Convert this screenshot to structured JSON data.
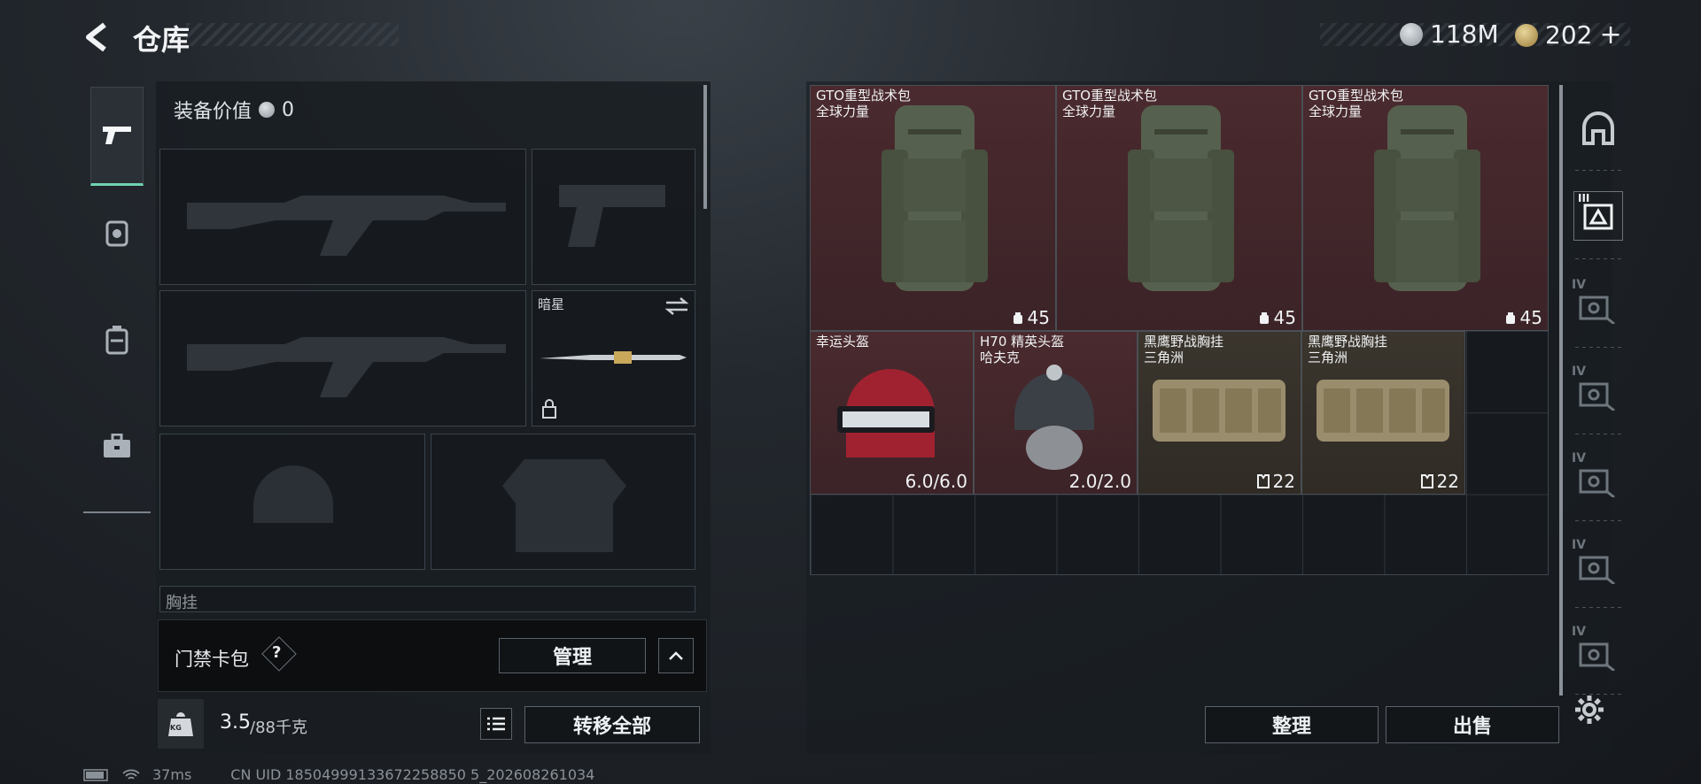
{
  "header": {
    "title": "仓库",
    "currency_silver": "118M",
    "currency_gold": "202",
    "add_symbol": "+"
  },
  "loadout": {
    "equip_value_label": "装备价值",
    "equip_value": "0",
    "melee_label": "暗星",
    "chest_label_partial": "胸挂",
    "card_label": "门禁卡包",
    "help_symbol": "?",
    "manage_button": "管理",
    "weight_value": "3.5",
    "weight_max": "/88千克",
    "transfer_all": "转移全部",
    "weight_icon_text": "KG"
  },
  "status": {
    "ping": "37ms",
    "uid": "CN UID 18504999133672258850 5_202608261034"
  },
  "items": [
    {
      "name": "GTO重型战术包",
      "sub": "全球力量",
      "value": "45",
      "type": "backpack",
      "color": "red"
    },
    {
      "name": "GTO重型战术包",
      "sub": "全球力量",
      "value": "45",
      "type": "backpack",
      "color": "red"
    },
    {
      "name": "GTO重型战术包",
      "sub": "全球力量",
      "value": "45",
      "type": "backpack",
      "color": "red"
    },
    {
      "name": "幸运头盔",
      "sub": "",
      "value": "6.0/6.0",
      "type": "helmet-red",
      "color": "red"
    },
    {
      "name": "H70 精英头盔",
      "sub": "哈夫克",
      "value": "2.0/2.0",
      "type": "helmet-grey",
      "color": "red"
    },
    {
      "name": "黑鹰野战胸挂",
      "sub": "三角洲",
      "value": "22",
      "type": "vest",
      "color": "brown"
    },
    {
      "name": "黑鹰野战胸挂",
      "sub": "三角洲",
      "value": "22",
      "type": "vest",
      "color": "brown"
    }
  ],
  "actions": {
    "sort": "整理",
    "sell": "出售"
  },
  "right_nav": {
    "tier_label": "IV",
    "badge": "III"
  },
  "colors": {
    "accent": "#6fd3b0",
    "red_cell": "#4a2a2e",
    "brown_cell": "#3a352d"
  }
}
